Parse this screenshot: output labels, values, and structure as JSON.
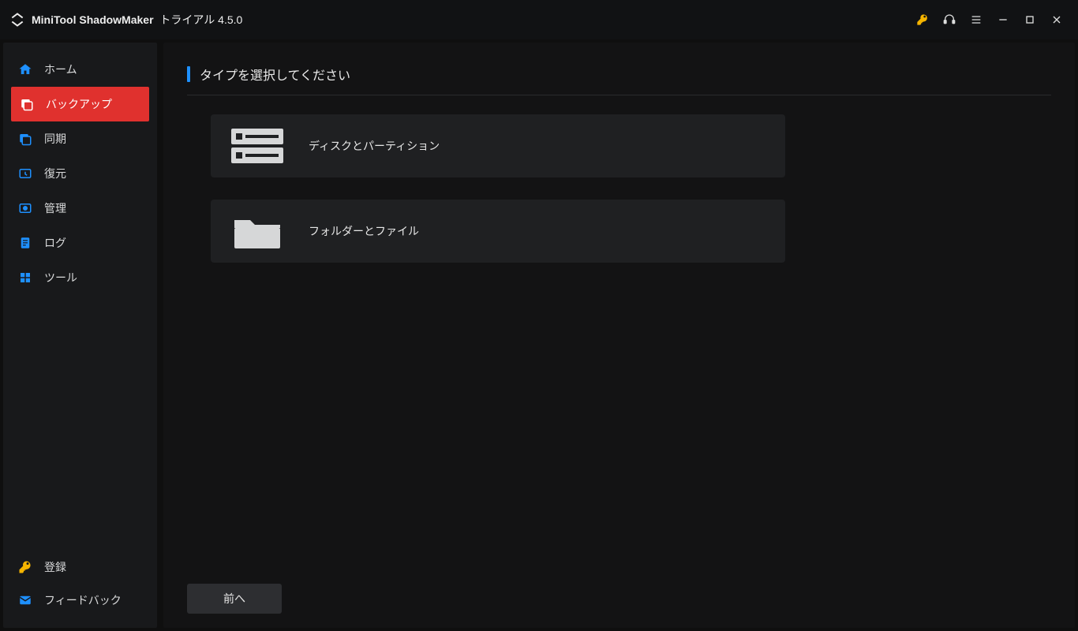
{
  "titlebar": {
    "app_name": "MiniTool ShadowMaker",
    "edition": "トライアル 4.5.0"
  },
  "sidebar": {
    "items": [
      {
        "label": "ホーム"
      },
      {
        "label": "バックアップ"
      },
      {
        "label": "同期"
      },
      {
        "label": "復元"
      },
      {
        "label": "管理"
      },
      {
        "label": "ログ"
      },
      {
        "label": "ツール"
      }
    ],
    "bottom": [
      {
        "label": "登録"
      },
      {
        "label": "フィードバック"
      }
    ]
  },
  "main": {
    "title": "タイプを選択してください",
    "options": [
      {
        "label": "ディスクとパーティション"
      },
      {
        "label": "フォルダーとファイル"
      }
    ],
    "prev_button": "前へ"
  }
}
